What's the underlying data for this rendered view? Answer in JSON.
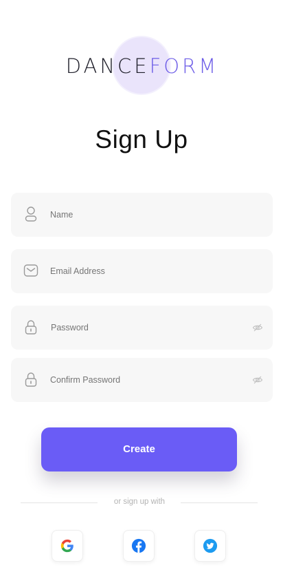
{
  "brand": {
    "logo_dark_part": "DANCE",
    "logo_accent_part": "FORM"
  },
  "page": {
    "title": "Sign Up"
  },
  "form": {
    "name_placeholder": "Name",
    "email_placeholder": "Email Address",
    "password_placeholder": "Password",
    "confirm_password_placeholder": "Confirm Password",
    "create_label": "Create"
  },
  "social": {
    "divider_text": "or sign up with",
    "providers": [
      {
        "name": "google",
        "icon": "google-icon"
      },
      {
        "name": "facebook",
        "icon": "facebook-icon"
      },
      {
        "name": "twitter",
        "icon": "twitter-icon"
      }
    ]
  },
  "colors": {
    "accent": "#6a5cf6",
    "logo_circle": "#eae4fb",
    "field_bg": "#f7f7f7",
    "facebook": "#1877f2",
    "twitter": "#1d9bf0"
  }
}
